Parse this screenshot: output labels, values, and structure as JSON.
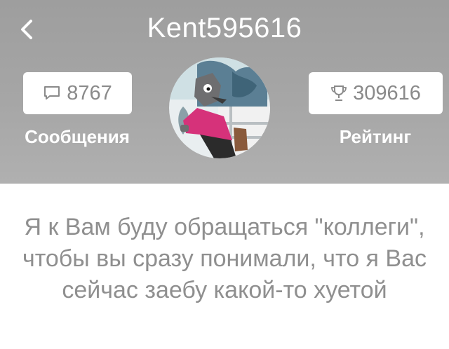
{
  "profile": {
    "username": "Kent595616",
    "messages_count": "8767",
    "messages_label": "Сообщения",
    "rating_value": "309616",
    "rating_label": "Рейтинг",
    "status_text": "Я к Вам буду обращаться \"коллеги\", чтобы вы сразу понимали, что я Вас сейчас заебу какой-то хуетой"
  },
  "icons": {
    "back": "chevron-left-icon",
    "messages": "speech-bubble-icon",
    "rating": "trophy-icon"
  },
  "colors": {
    "header_bg": "#a6a6a6",
    "stat_text": "#8a8a8a",
    "message_text": "#8f8f8f"
  }
}
